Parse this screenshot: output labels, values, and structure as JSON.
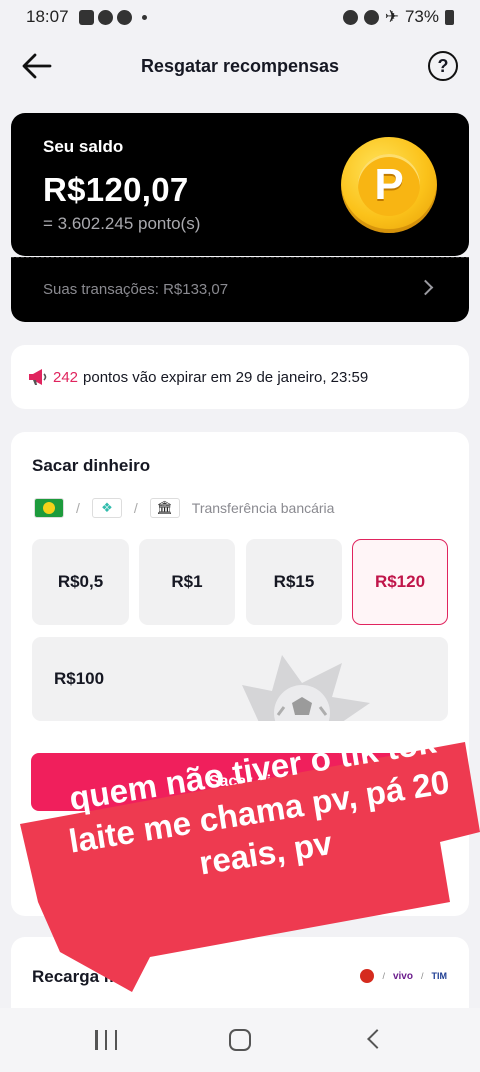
{
  "status_bar": {
    "time": "18:07",
    "battery": "73%"
  },
  "header": {
    "title": "Resgatar recompensas",
    "help_label": "?"
  },
  "balance": {
    "label": "Seu saldo",
    "amount": "R$120,07",
    "points": "= 3.602.245 ponto(s)",
    "coin_letter": "P"
  },
  "transactions": {
    "label": "Suas transações: R$133,07"
  },
  "expire": {
    "count": "242",
    "text": "pontos vão expirar em 29 de janeiro, 23:59"
  },
  "cashout": {
    "title": "Sacar dinheiro",
    "methods_separator": "/",
    "method_bank_label": "Transferência bancária",
    "options": [
      {
        "label": "R$0,5",
        "selected": false
      },
      {
        "label": "R$1",
        "selected": false
      },
      {
        "label": "R$15",
        "selected": false
      },
      {
        "label": "R$120",
        "selected": true
      },
      {
        "label": "R$100",
        "selected": false
      }
    ],
    "button_label": "Sacar di"
  },
  "recharge": {
    "title": "Recarga m",
    "operators": [
      "vivo",
      "TIM"
    ]
  },
  "overlay": {
    "text": "quem não tiver o tik tok laite me chama pv, pá 20 reais, pv",
    "bg_color": "#ee3a50"
  },
  "colors": {
    "accent": "#f01f5c",
    "selected_text": "#c0154a",
    "coin": "#fbc21a"
  }
}
